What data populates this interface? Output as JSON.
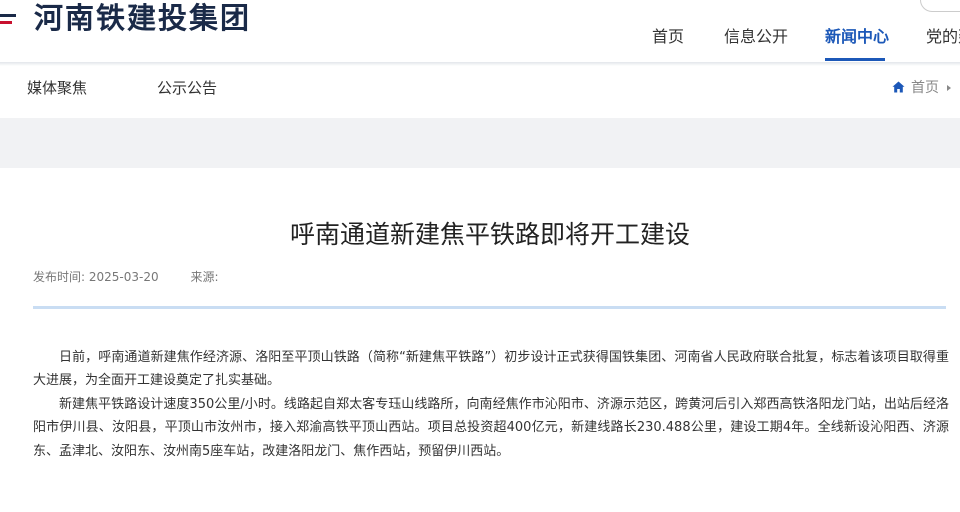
{
  "brand": {
    "name": "河南铁建投集团",
    "accent": "#1c58b8",
    "dark": "#1a2a48"
  },
  "top_links": [
    {
      "icon": "dot-icon"
    },
    {
      "icon": "dot-icon"
    },
    {
      "icon": "dot-icon"
    }
  ],
  "nav": {
    "items": [
      {
        "label": "首页"
      },
      {
        "label": "信息公开"
      },
      {
        "label": "新闻中心",
        "active": true
      },
      {
        "label": "党的建设"
      }
    ]
  },
  "subnav": {
    "items": [
      {
        "label": "媒体聚焦"
      },
      {
        "label": "公示公告"
      }
    ]
  },
  "breadcrumb": {
    "home": "首页"
  },
  "article": {
    "title": "呼南通道新建焦平铁路即将开工建设",
    "publish_label": "发布时间:",
    "publish_date": "2025-03-20",
    "source_label": "来源:",
    "paragraphs": [
      "日前，呼南通道新建焦作经济源、洛阳至平顶山铁路（简称“新建焦平铁路”）初步设计正式获得国铁集团、河南省人民政府联合批复，标志着该项目取得重大进展，为全面开工建设奠定了扎实基础。",
      "新建焦平铁路设计速度350公里/小时。线路起自郑太客专珏山线路所，向南经焦作市沁阳市、济源示范区，跨黄河后引入郑西高铁洛阳龙门站，出站后经洛阳市伊川县、汝阳县，平顶山市汝州市，接入郑渝高铁平顶山西站。项目总投资超400亿元，新建线路长230.488公里，建设工期4年。全线新设沁阳西、济源东、孟津北、汝阳东、汝州南5座车站，改建洛阳龙门、焦作西站，预留伊川西站。"
    ]
  }
}
